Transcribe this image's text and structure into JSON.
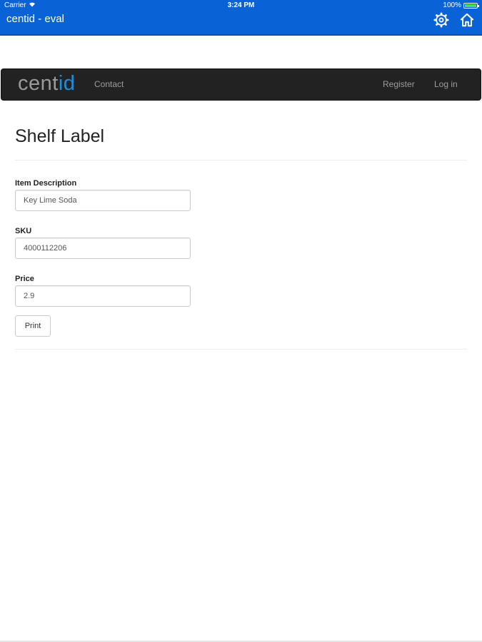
{
  "status_bar": {
    "carrier": "Carrier",
    "time": "3:24 PM",
    "battery_text": "100%",
    "battery_level": 1.0
  },
  "title_bar": {
    "title": "centid - eval",
    "icons": [
      "gear-icon",
      "home-icon"
    ]
  },
  "navbar": {
    "brand_part1": "cent",
    "brand_part2": "id",
    "links": {
      "contact": "Contact",
      "register": "Register",
      "login": "Log in"
    }
  },
  "form": {
    "heading": "Shelf Label",
    "item_description": {
      "label": "Item Description",
      "value": "Key Lime Soda"
    },
    "sku": {
      "label": "SKU",
      "value": "4000112206"
    },
    "price": {
      "label": "Price",
      "value": "2.9"
    },
    "print_button": "Print"
  },
  "colors": {
    "title_bar": "#0a63d6",
    "navbar": "#222222",
    "brand_accent": "#1e8fdc",
    "battery": "#4cd964"
  }
}
